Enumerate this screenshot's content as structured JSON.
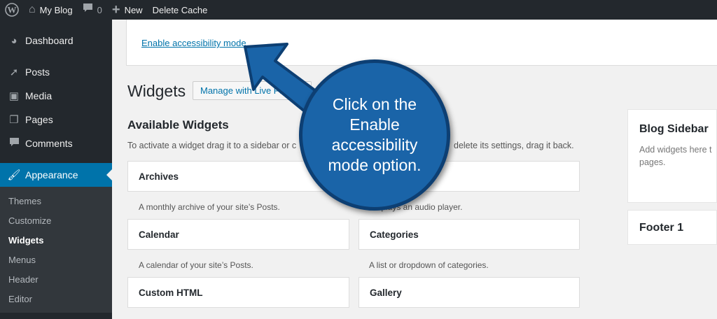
{
  "adminbar": {
    "site_name": "My Blog",
    "comments_count": "0",
    "new_label": "New",
    "delete_cache_label": "Delete Cache"
  },
  "menu": {
    "items": [
      {
        "label": "Dashboard",
        "icon": "dashboard-icon"
      },
      {
        "label": "Posts",
        "icon": "pin-icon"
      },
      {
        "label": "Media",
        "icon": "media-icon"
      },
      {
        "label": "Pages",
        "icon": "pages-icon"
      },
      {
        "label": "Comments",
        "icon": "comments-icon"
      },
      {
        "label": "Appearance",
        "icon": "paintbrush-icon"
      }
    ],
    "submenu": [
      "Themes",
      "Customize",
      "Widgets",
      "Menus",
      "Header",
      "Editor"
    ],
    "current_submenu": "Widgets"
  },
  "notice": {
    "link": "Enable accessibility mode"
  },
  "page": {
    "title": "Widgets",
    "live_preview_button": "Manage with Live Preview",
    "available_title": "Available Widgets",
    "available_desc_start": "To activate a widget drag it to a sidebar or c",
    "available_desc_end": "delete its settings, drag it back."
  },
  "widgets": [
    {
      "title": "Archives",
      "desc": "A monthly archive of your site’s Posts."
    },
    {
      "title": "",
      "desc": "Displays an audio player."
    },
    {
      "title": "Calendar",
      "desc": "A calendar of your site’s Posts."
    },
    {
      "title": "Categories",
      "desc": "A list or dropdown of categories."
    },
    {
      "title": "Custom HTML",
      "desc": ""
    },
    {
      "title": "Gallery",
      "desc": ""
    }
  ],
  "sidebars": [
    {
      "title": "Blog Sidebar",
      "desc": "Add widgets here t pages."
    },
    {
      "title": "Footer 1"
    }
  ],
  "callout": {
    "text": "Click on the Enable accessibility mode option."
  },
  "colors": {
    "accent": "#0073aa",
    "callout": "#1a64a8",
    "callout_border": "#0d3f73"
  }
}
